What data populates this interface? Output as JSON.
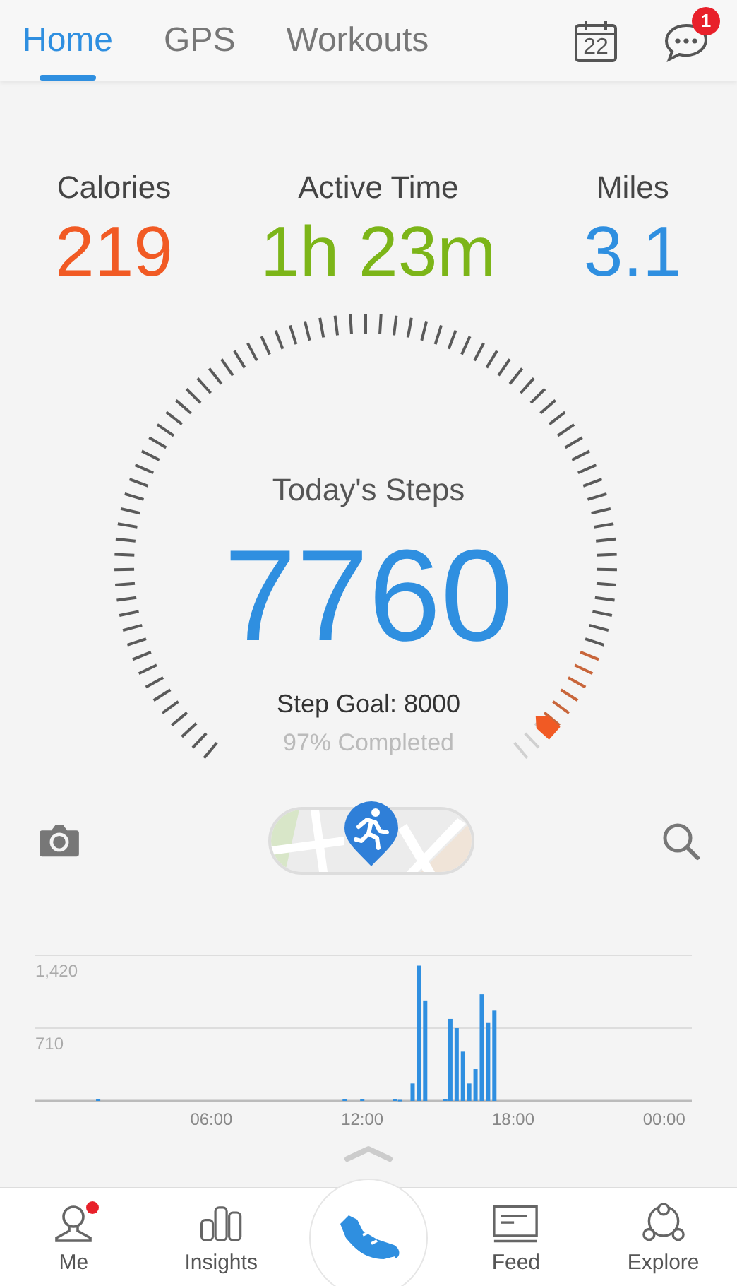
{
  "tabs": [
    {
      "label": "Home",
      "selected": true
    },
    {
      "label": "GPS",
      "selected": false
    },
    {
      "label": "Workouts",
      "selected": false
    }
  ],
  "calendar": {
    "day": "22"
  },
  "messages": {
    "badge": "1"
  },
  "stats": [
    {
      "label": "Calories",
      "value": "219",
      "color": "#f15a24"
    },
    {
      "label": "Active Time",
      "value": "1h 23m",
      "color": "#7cb518"
    },
    {
      "label": "Miles",
      "value": "3.1",
      "color": "#2f8fe0"
    }
  ],
  "steps": {
    "title": "Today's Steps",
    "count": "7760",
    "goal": "Step Goal: 8000",
    "completed": "97% Completed"
  },
  "activity": {
    "chart_data": {
      "type": "bar",
      "x": [
        1.5,
        11.3,
        12,
        13.3,
        13.5,
        14,
        14.25,
        14.5,
        15.3,
        15.5,
        15.75,
        16,
        16.25,
        16.5,
        16.75,
        17,
        17.25
      ],
      "series": [
        {
          "color": "#2f8fe0",
          "values": [
            20,
            20,
            20,
            20,
            10,
            170,
            1320,
            980,
            20,
            800,
            710,
            480,
            170,
            310,
            1040,
            760,
            880
          ]
        }
      ],
      "xlim": [
        -1,
        25.1
      ],
      "ylim": [
        0,
        1420
      ],
      "xticks": [
        {
          "value": 6,
          "label": "06:00"
        },
        {
          "value": 12,
          "label": "12:00"
        },
        {
          "value": 18,
          "label": "18:00"
        },
        {
          "value": 24,
          "label": "00:00"
        }
      ],
      "yticks": [
        {
          "value": 710,
          "label": "710"
        },
        {
          "value": 1420,
          "label": "1,420"
        }
      ]
    }
  },
  "nav": [
    {
      "kind": "person",
      "label": "Me",
      "dot": true
    },
    {
      "kind": "bars",
      "label": "Insights",
      "dot": false
    },
    {
      "kind": "shoe"
    },
    {
      "kind": "feed",
      "label": "Feed",
      "dot": false
    },
    {
      "kind": "explore",
      "label": "Explore",
      "dot": false
    }
  ]
}
